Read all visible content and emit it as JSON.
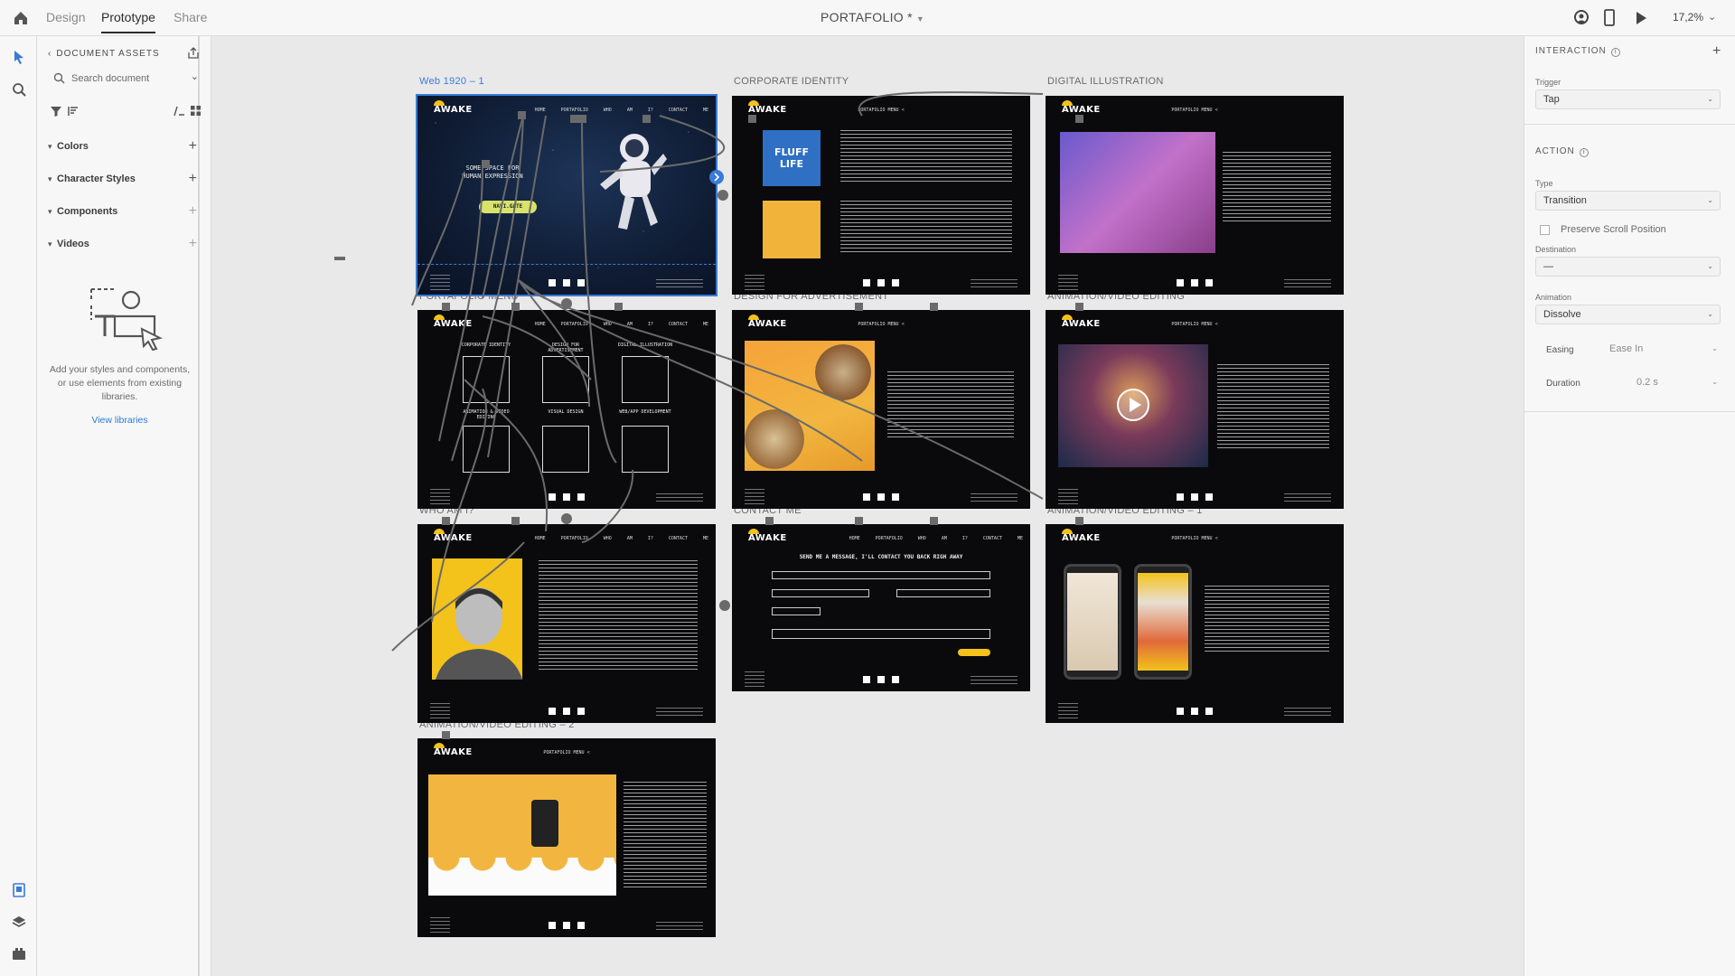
{
  "topbar": {
    "tabs": [
      {
        "label": "Design"
      },
      {
        "label": "Prototype"
      },
      {
        "label": "Share"
      }
    ],
    "document_title": "PORTAFOLIO *",
    "zoom": "17,2%"
  },
  "assets": {
    "heading": "DOCUMENT ASSETS",
    "search_placeholder": "Search document",
    "sections": [
      {
        "label": "Colors"
      },
      {
        "label": "Character Styles"
      },
      {
        "label": "Components"
      },
      {
        "label": "Videos"
      }
    ],
    "empty_text": "Add your styles and components, or use elements from existing libraries.",
    "view_libraries": "View libraries"
  },
  "canvas": {
    "artboards": [
      {
        "label": "Web 1920 – 1",
        "nav": "HOME   PORTAFOLIO   WHO AM I?   CONTACT ME",
        "hero_text": "SOME SPACE FOR HUMAN EXPRESSION",
        "cta": "NAVI.GATE"
      },
      {
        "label": "CORPORATE IDENTITY",
        "nav": "PORTAFOLIO MENU <",
        "tile_text": "FLUFF LIFE"
      },
      {
        "label": "DIGITAL ILLUSTRATION",
        "nav": "PORTAFOLIO MENU <"
      },
      {
        "label": "PORTAFOLIO MENU",
        "nav": "HOME   PORTAFOLIO   WHO AM I?   CONTACT ME",
        "items": [
          "CORPORATE IDENTITY",
          "DESIGN FOR ADVERTISEMENT",
          "DIGITAL ILLUSTRATION",
          "ANIMATION & VIDEO EDITING",
          "VISUAL DESIGN",
          "WEB/APP DEVELOPMENT"
        ]
      },
      {
        "label": "DESIGN FOR ADVERTISEMENT",
        "nav": "PORTAFOLIO MENU <"
      },
      {
        "label": "ANIMATION/VIDEO EDITING",
        "nav": "PORTAFOLIO MENU <"
      },
      {
        "label": "WHO AM I?",
        "nav": "HOME   PORTAFOLIO   WHO AM I?   CONTACT ME"
      },
      {
        "label": "CONTACT ME",
        "nav": "HOME   PORTAFOLIO   WHO AM I?   CONTACT ME",
        "heading": "SEND ME A MESSAGE, I'LL CONTACT YOU BACK RIGH AWAY"
      },
      {
        "label": "ANIMATION/VIDEO EDITING – 1",
        "nav": "PORTAFOLIO MENU <"
      },
      {
        "label": "ANIMATION/VIDEO EDITING – 2",
        "nav": "PORTAFOLIO MENU <"
      }
    ],
    "logo_text": "AWAKE"
  },
  "inspector": {
    "interaction_heading": "INTERACTION",
    "trigger_label": "Trigger",
    "trigger_value": "Tap",
    "action_heading": "ACTION",
    "type_label": "Type",
    "type_value": "Transition",
    "preserve_scroll": "Preserve Scroll Position",
    "destination_label": "Destination",
    "destination_value": "—",
    "animation_label": "Animation",
    "animation_value": "Dissolve",
    "easing_label": "Easing",
    "easing_value": "Ease In",
    "duration_label": "Duration",
    "duration_value": "0.2 s"
  },
  "colors": {
    "accent": "#3a7ad8",
    "brand_yellow": "#f3c21b",
    "wire": "#6a6a6a"
  }
}
